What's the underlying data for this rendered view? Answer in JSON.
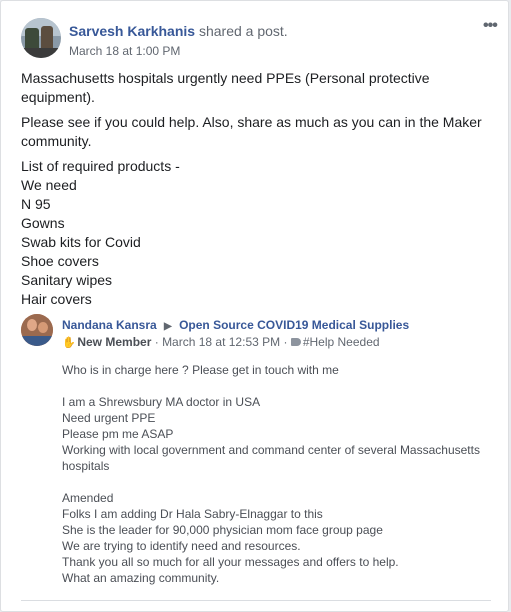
{
  "post": {
    "author": "Sarvesh Karkhanis",
    "action": "shared a post.",
    "timestamp": "March 18 at 1:00 PM",
    "more_glyph": "•••",
    "paragraphs": [
      "Massachusetts hospitals urgently need PPEs (Personal protective equipment).",
      "Please see if you could help. Also, share as much as you can in the Maker community."
    ],
    "list_lines": [
      "List of required products -",
      "We need",
      "N 95",
      "Gowns",
      "Swab kits for Covid",
      "Shoe covers",
      "Sanitary wipes",
      "Hair covers"
    ]
  },
  "shared": {
    "author": "Nandana Kansra",
    "arrow": "▶",
    "group": "Open Source COVID19 Medical Supplies",
    "badge": "New Member",
    "separator": "·",
    "timestamp": "March 18 at 12:53 PM",
    "tag": "#Help Needed",
    "paragraphs": [
      [
        "Who is in charge here ? Please get in touch with me"
      ],
      [
        "I am a Shrewsbury MA doctor in USA",
        "Need urgent PPE",
        "Please pm me ASAP",
        "Working with local government and command center of several Massachusetts hospitals"
      ],
      [
        "Amended",
        "Folks I am adding Dr Hala Sabry-Elnaggar to this",
        "She is the leader for 90,000 physician mom face group page",
        "We are trying to identify need and resources.",
        "Thank you all so much for all your messages and offers to help.",
        "What an amazing community."
      ]
    ]
  }
}
